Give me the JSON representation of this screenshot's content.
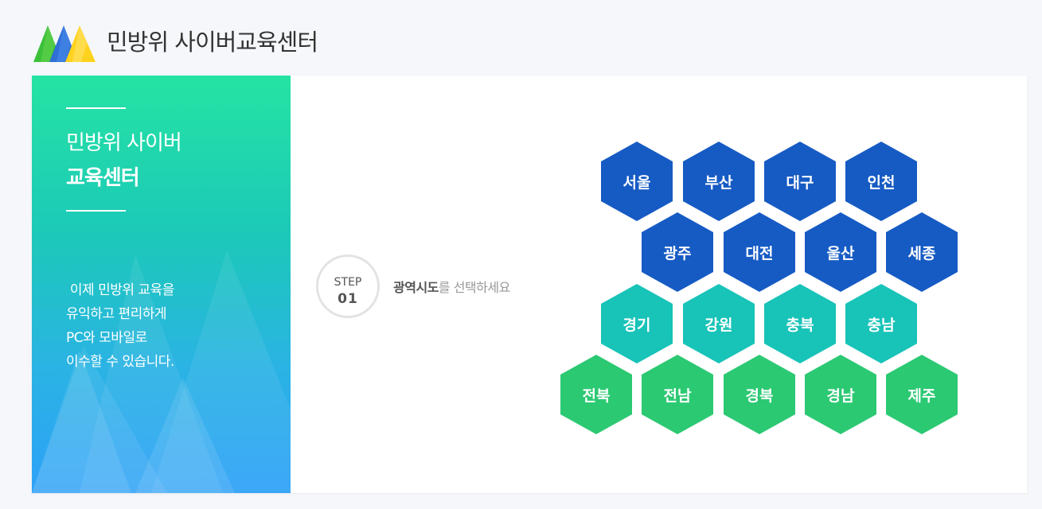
{
  "header": {
    "title": "민방위 사이버교육센터"
  },
  "sidebar": {
    "title_line1": "민방위 사이버",
    "title_line2": "교육센터",
    "desc": [
      " 이제 민방위 교육을",
      "유익하고 편리하게",
      "PC와 모바일로",
      "이수할 수 있습니다."
    ]
  },
  "step": {
    "label": "STEP",
    "number": "01",
    "instruction_bold": "광역시도",
    "instruction_rest": "를 선택하세요"
  },
  "regions": [
    {
      "name": "서울",
      "color": "blue"
    },
    {
      "name": "부산",
      "color": "blue"
    },
    {
      "name": "대구",
      "color": "blue"
    },
    {
      "name": "인천",
      "color": "blue"
    },
    {
      "name": "광주",
      "color": "blue"
    },
    {
      "name": "대전",
      "color": "blue"
    },
    {
      "name": "울산",
      "color": "blue"
    },
    {
      "name": "세종",
      "color": "blue"
    },
    {
      "name": "경기",
      "color": "teal"
    },
    {
      "name": "강원",
      "color": "teal"
    },
    {
      "name": "충북",
      "color": "teal"
    },
    {
      "name": "충남",
      "color": "teal"
    },
    {
      "name": "전북",
      "color": "green"
    },
    {
      "name": "전남",
      "color": "green"
    },
    {
      "name": "경북",
      "color": "green"
    },
    {
      "name": "경남",
      "color": "green"
    },
    {
      "name": "제주",
      "color": "green"
    }
  ],
  "colors": {
    "blue": "#165bc4",
    "teal": "#18c3b8",
    "green": "#2cc973"
  }
}
